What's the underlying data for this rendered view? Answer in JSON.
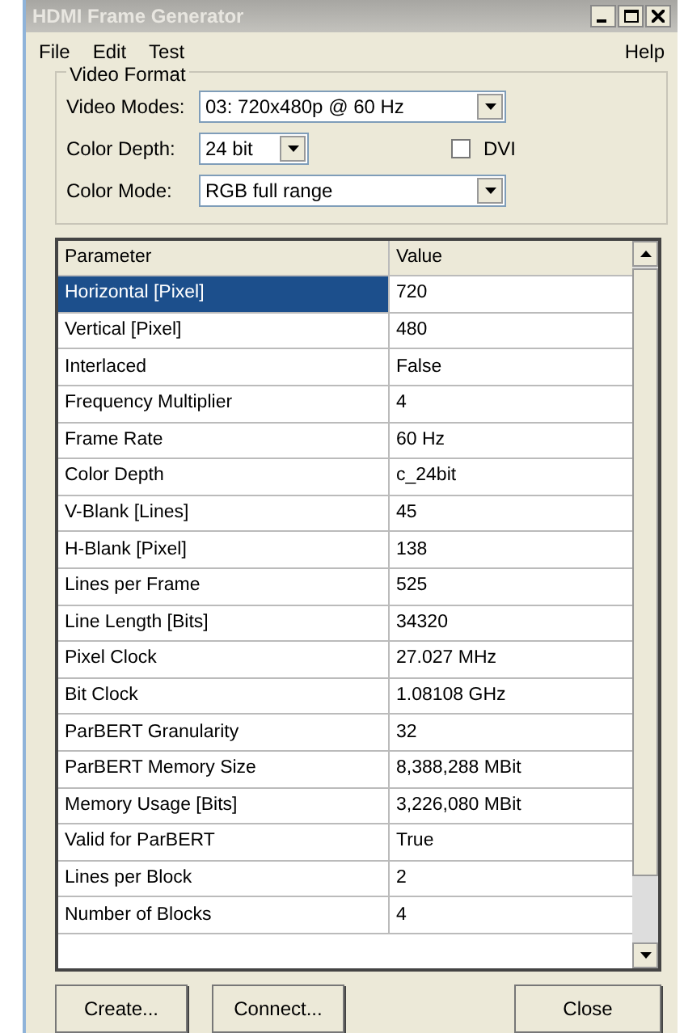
{
  "window": {
    "title": "HDMI Frame Generator"
  },
  "menu": {
    "left": [
      "File",
      "Edit",
      "Test"
    ],
    "right": [
      "Help"
    ]
  },
  "video_format": {
    "title": "Video Format",
    "video_modes": {
      "label": "Video Modes:",
      "value": "03: 720x480p @ 60 Hz"
    },
    "color_depth": {
      "label": "Color Depth:",
      "value": "24 bit"
    },
    "dvi": {
      "label": "DVI",
      "checked": false
    },
    "color_mode": {
      "label": "Color Mode:",
      "value": "RGB full range"
    }
  },
  "table": {
    "columns": [
      "Parameter",
      "Value"
    ],
    "rows": [
      {
        "parameter": "Horizontal [Pixel]",
        "value": "720",
        "selected": true
      },
      {
        "parameter": "Vertical [Pixel]",
        "value": "480",
        "selected": false
      },
      {
        "parameter": "Interlaced",
        "value": "False",
        "selected": false
      },
      {
        "parameter": "Frequency Multiplier",
        "value": "4",
        "selected": false
      },
      {
        "parameter": "Frame Rate",
        "value": "60 Hz",
        "selected": false
      },
      {
        "parameter": "Color Depth",
        "value": "c_24bit",
        "selected": false
      },
      {
        "parameter": "V-Blank [Lines]",
        "value": "45",
        "selected": false
      },
      {
        "parameter": "H-Blank [Pixel]",
        "value": "138",
        "selected": false
      },
      {
        "parameter": "Lines per Frame",
        "value": "525",
        "selected": false
      },
      {
        "parameter": "Line Length [Bits]",
        "value": "34320",
        "selected": false
      },
      {
        "parameter": "Pixel Clock",
        "value": "27.027 MHz",
        "selected": false
      },
      {
        "parameter": "Bit Clock",
        "value": "1.08108 GHz",
        "selected": false
      },
      {
        "parameter": "ParBERT Granularity",
        "value": "32",
        "selected": false
      },
      {
        "parameter": "ParBERT Memory Size",
        "value": "8,388,288 MBit",
        "selected": false
      },
      {
        "parameter": "Memory Usage [Bits]",
        "value": "3,226,080 MBit",
        "selected": false
      },
      {
        "parameter": "Valid for ParBERT",
        "value": "True",
        "selected": false
      },
      {
        "parameter": "Lines per Block",
        "value": "2",
        "selected": false
      },
      {
        "parameter": "Number of Blocks",
        "value": "4",
        "selected": false
      }
    ]
  },
  "buttons": [
    {
      "label": "Create...",
      "kind": "left"
    },
    {
      "label": "Connect...",
      "kind": "left"
    },
    {
      "label": "Close",
      "kind": "right"
    }
  ]
}
